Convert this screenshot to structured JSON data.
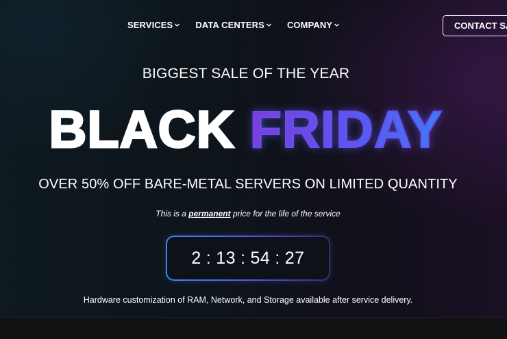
{
  "nav": {
    "items": [
      {
        "label": "SERVICES"
      },
      {
        "label": "DATA CENTERS"
      },
      {
        "label": "COMPANY"
      }
    ],
    "contact_label": "CONTACT SALES"
  },
  "hero": {
    "kicker": "BIGGEST SALE OF THE YEAR",
    "headline_part1": "BLACK",
    "headline_part2": "FRIDAY",
    "offer": "OVER 50% OFF BARE-METAL SERVERS ON LIMITED QUANTITY",
    "note_before": "This is a ",
    "note_emphasis": "permanent",
    "note_after": " price for the life of the service",
    "footnote": "Hardware customization of RAM, Network, and Storage available after service delivery."
  },
  "countdown": {
    "days": "2",
    "hours": "13",
    "minutes": "54",
    "seconds": "27",
    "separator": ":"
  },
  "colors": {
    "accent_purple": "#7a3fd9",
    "accent_blue": "#3c7cf4"
  }
}
